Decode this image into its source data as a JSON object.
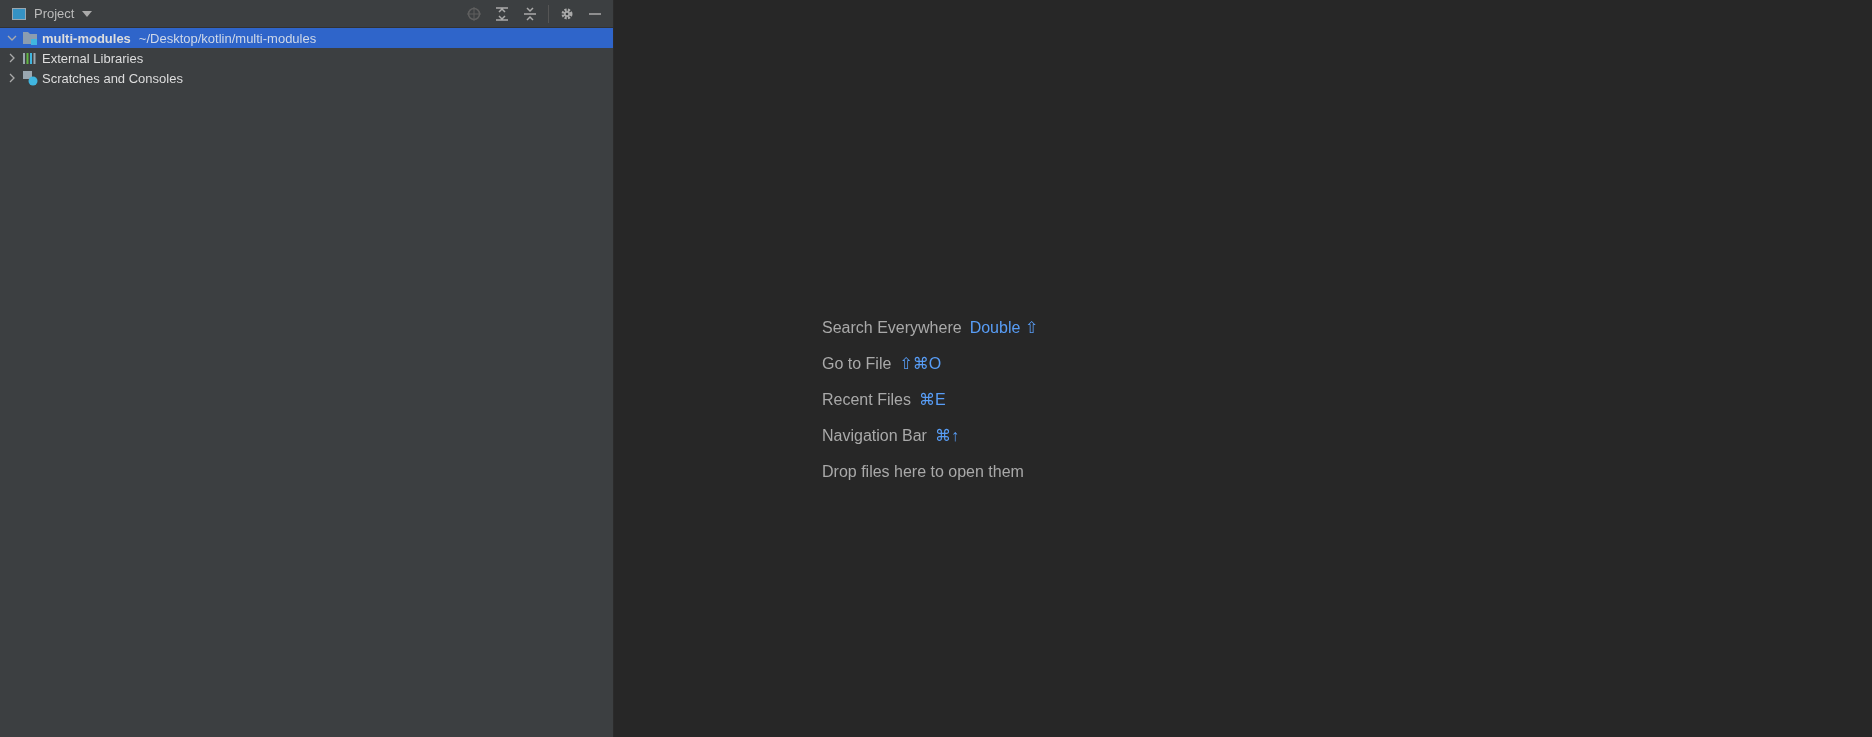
{
  "project_panel": {
    "title": "Project",
    "tree": [
      {
        "label": "multi-modules",
        "path": "~/Desktop/kotlin/multi-modules",
        "kind": "module",
        "expanded": true,
        "selected": true
      },
      {
        "label": "External Libraries",
        "kind": "libraries",
        "expanded": false,
        "selected": false
      },
      {
        "label": "Scratches and Consoles",
        "kind": "scratches",
        "expanded": false,
        "selected": false
      }
    ]
  },
  "editor": {
    "hints": [
      {
        "label": "Search Everywhere",
        "shortcut": "Double ⇧"
      },
      {
        "label": "Go to File",
        "shortcut": "⇧⌘O"
      },
      {
        "label": "Recent Files",
        "shortcut": "⌘E"
      },
      {
        "label": "Navigation Bar",
        "shortcut": "⌘↑"
      },
      {
        "label": "Drop files here to open them"
      }
    ]
  }
}
